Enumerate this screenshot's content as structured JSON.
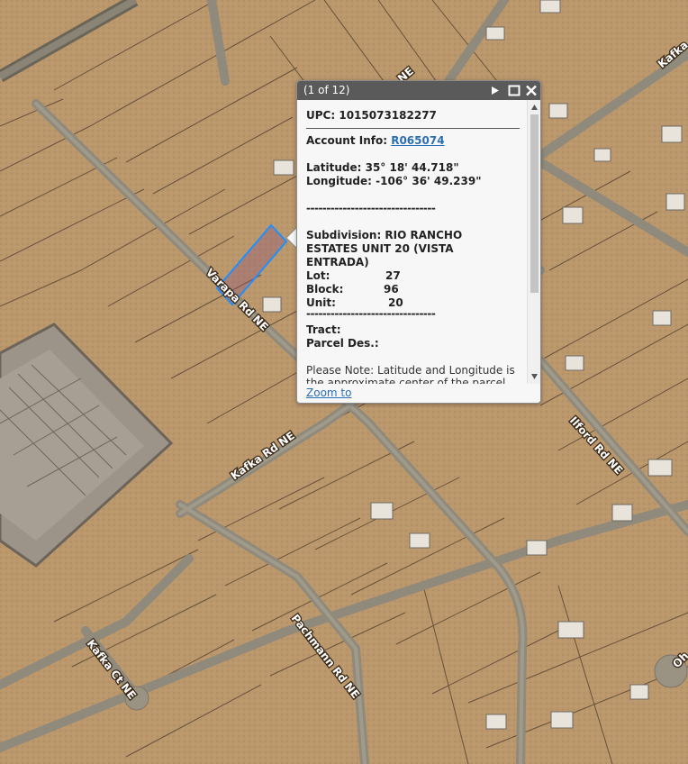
{
  "map": {
    "road_labels": [
      "Varapa Rd NE",
      "Kafka Rd NE",
      "Ilford Rd NE",
      "Pachmann Rd NE",
      "Kafka Ct NE",
      "Kafka",
      "NE",
      "Oh"
    ],
    "colors": {
      "terrain": "#b9966c",
      "road": "#8f8a7c",
      "parcel_line": "#4a3a28",
      "highlight": "#1e90ff"
    }
  },
  "popup": {
    "counter": "(1 of 12)",
    "icons": [
      "play-next-icon",
      "maximize-icon",
      "close-icon"
    ],
    "upc_label": "UPC:",
    "upc_value": "1015073182277",
    "account_label": "Account Info:",
    "account_value": "R065074",
    "latitude_label": "Latitude:",
    "latitude_value": "35° 18' 44.718\"",
    "longitude_label": "Longitude:",
    "longitude_value": "-106° 36' 49.239\"",
    "dashes": "--------------------------------",
    "subdivision_line1": "Subdivision: RIO RANCHO",
    "subdivision_line2": "ESTATES UNIT 20 (VISTA",
    "subdivision_line3": "ENTRADA)",
    "lot_label": "Lot:",
    "lot_value": "27",
    "block_label": "Block:",
    "block_value": "96",
    "unit_label": "Unit:",
    "unit_value": "20",
    "tract_label": "Tract:",
    "parcel_label": "Parcel Des.:",
    "note": "Please Note: Latitude and Longitude is the approximate center of the parcel.",
    "zoom_link": "Zoom to"
  }
}
